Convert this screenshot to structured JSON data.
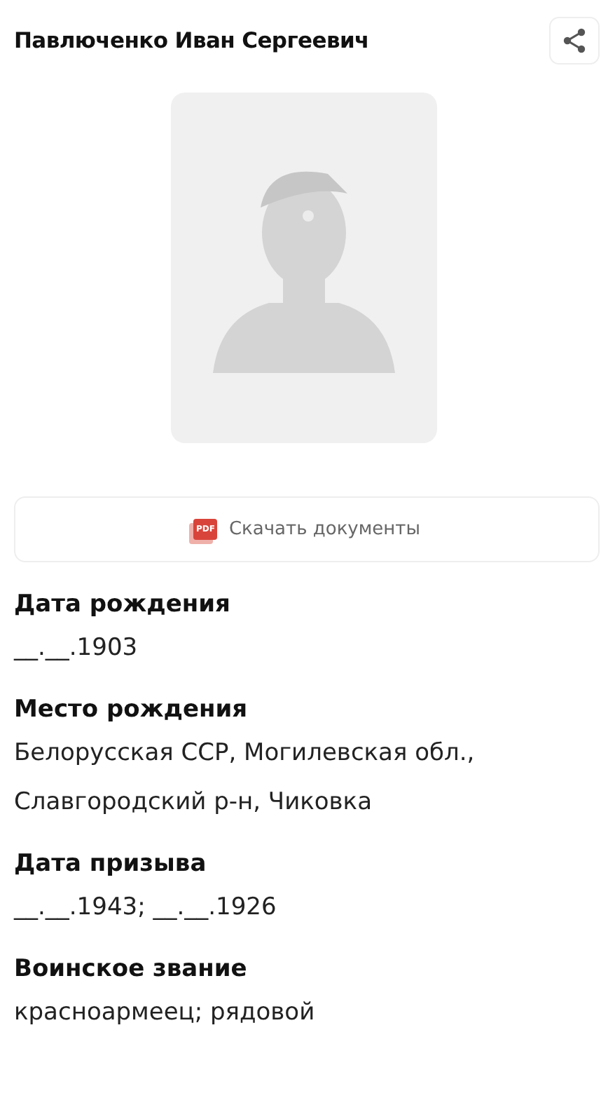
{
  "title": "Павлюченко Иван Сергеевич",
  "download": {
    "icon_label": "PDF",
    "label": "Скачать документы"
  },
  "fields": [
    {
      "label": "Дата рождения",
      "lines": [
        "__.__.1903"
      ]
    },
    {
      "label": "Место рождения",
      "lines": [
        "Белорусская ССР, Могилевская обл.,",
        "Славгородский р-н, Чиковка"
      ]
    },
    {
      "label": "Дата призыва",
      "lines": [
        "__.__.1943; __.__.1926"
      ]
    },
    {
      "label": "Воинское звание",
      "lines": [
        "красноармеец; рядовой"
      ]
    }
  ]
}
